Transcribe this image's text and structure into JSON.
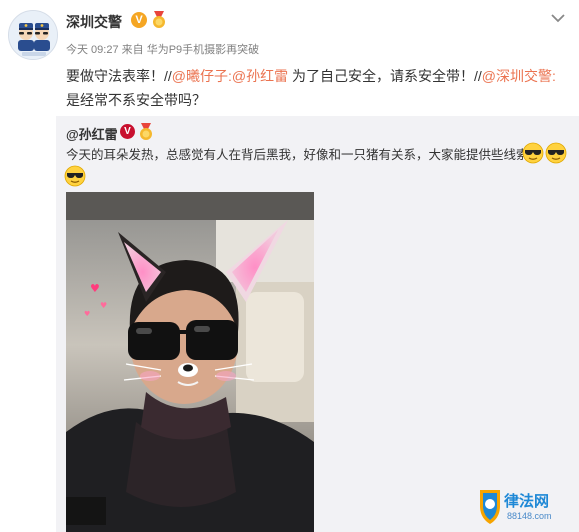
{
  "post": {
    "author": "深圳交警",
    "verified_badge": "V",
    "meta_time": "今天 09:27",
    "meta_from": "来自",
    "meta_source": "华为P9手机摄影再突破",
    "text_prefix": "要做守法表率！//",
    "mention_1": "@曦仔子",
    "text_1": ":",
    "mention_2": "@孙红雷",
    "text_2": "  为了自己安全，请系安全带！//",
    "mention_3": "@深圳交警",
    "text_3": ":",
    "text_line2": "是经常不系安全带吗？"
  },
  "repost": {
    "author": "@孙红雷",
    "verified_badge": "V",
    "text": "今天的耳朵发热，总感觉有人在背后黑我，好像和一只猪有关系，大家能提供些线索吗"
  },
  "watermark": {
    "name": "律法网",
    "url": "88148.com"
  },
  "icons": {
    "avatar": "traffic-police-avatar",
    "medal": "medal-icon",
    "menu": "chevron-down-icon",
    "emoji": "cool-sunglasses-emoji"
  },
  "colors": {
    "mention": "#eb7350",
    "repost_bg": "#f2f2f5",
    "meta": "#808080"
  }
}
